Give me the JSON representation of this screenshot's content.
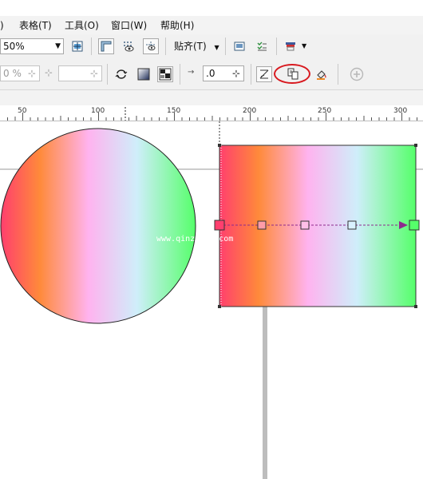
{
  "menu": {
    "items": [
      {
        "label": ")"
      },
      {
        "label": "表格(T)"
      },
      {
        "label": "工具(O)"
      },
      {
        "label": "窗口(W)"
      },
      {
        "label": "帮助(H)"
      }
    ]
  },
  "toolbar1": {
    "zoom_value": "50%",
    "snap_label": "贴齐(T)"
  },
  "toolbar2": {
    "pct_value": "0 %",
    "stroke_value": ".0"
  },
  "ruler": {
    "ticks": [
      "50",
      "100",
      "150",
      "200",
      "250",
      "300"
    ]
  },
  "canvas": {
    "watermark": "www.qinzhang.com"
  },
  "colors": {
    "gradient_stops": [
      "#ff3f6e",
      "#ff8a3a",
      "#ffb3ef",
      "#cfeefa",
      "#55ff6a"
    ],
    "highlight": "#d8191f",
    "interactive_arrow": "#8e2a8e"
  }
}
